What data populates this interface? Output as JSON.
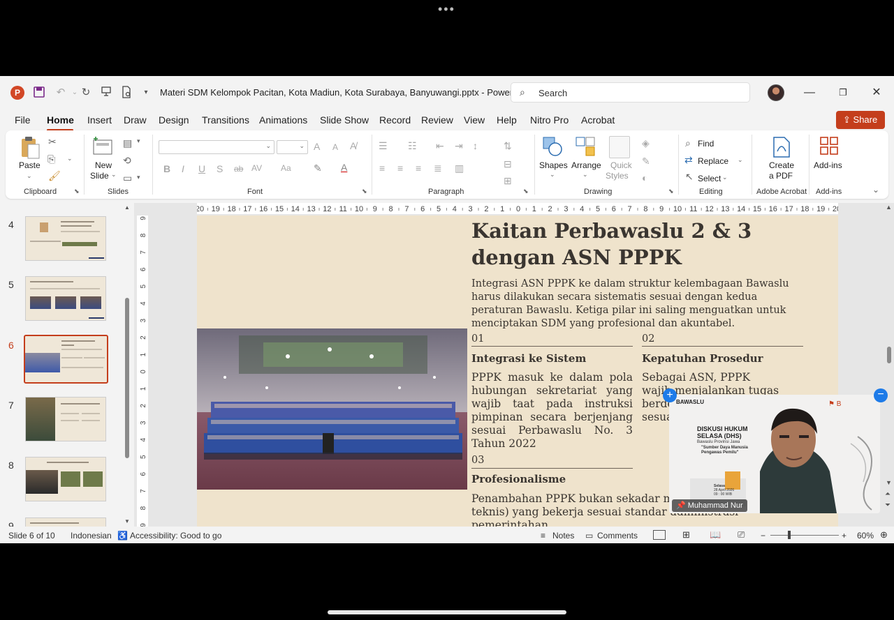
{
  "overlay": {
    "more_dots": "•••"
  },
  "titlebar": {
    "file_name": "Materi SDM Kelompok Pacitan, Kota Madiun, Kota Surabaya, Banyuwangi.pptx  -  PowerP...",
    "search_placeholder": "Search"
  },
  "menu": {
    "items": [
      "File",
      "Home",
      "Insert",
      "Draw",
      "Design",
      "Transitions",
      "Animations",
      "Slide Show",
      "Record",
      "Review",
      "View",
      "Help",
      "Nitro Pro",
      "Acrobat"
    ],
    "active": "Home",
    "share_label": "Share"
  },
  "ribbon": {
    "clipboard": {
      "paste": "Paste",
      "group": "Clipboard"
    },
    "slides": {
      "new_slide_line1": "New",
      "new_slide_line2": "Slide",
      "group": "Slides"
    },
    "font": {
      "group": "Font",
      "bold": "B",
      "italic": "I",
      "underline": "U",
      "shadow": "S",
      "strike": "ab",
      "spacing": "AV",
      "case": "Aa",
      "grow": "A",
      "shrink": "A"
    },
    "paragraph": {
      "group": "Paragraph"
    },
    "drawing": {
      "shapes": "Shapes",
      "arrange": "Arrange",
      "quick_styles_line1": "Quick",
      "quick_styles_line2": "Styles",
      "group": "Drawing"
    },
    "editing": {
      "find": "Find",
      "replace": "Replace",
      "select": "Select",
      "group": "Editing"
    },
    "acrobat": {
      "create_pdf_line1": "Create",
      "create_pdf_line2": "a PDF",
      "group": "Adobe Acrobat"
    },
    "addins": {
      "label": "Add-ins",
      "group": "Add-ins"
    }
  },
  "thumbnails": [
    {
      "number": "4",
      "active": false
    },
    {
      "number": "5",
      "active": false
    },
    {
      "number": "6",
      "active": true
    },
    {
      "number": "7",
      "active": false
    },
    {
      "number": "8",
      "active": false
    },
    {
      "number": "9",
      "active": false
    }
  ],
  "ruler": {
    "horizontal": [
      "20",
      "19",
      "18",
      "17",
      "16",
      "15",
      "14",
      "13",
      "12",
      "11",
      "10",
      "9",
      "8",
      "7",
      "6",
      "5",
      "4",
      "3",
      "2",
      "1",
      "0",
      "1",
      "2",
      "3",
      "4",
      "5",
      "6",
      "7",
      "8",
      "9",
      "10",
      "11",
      "12",
      "13",
      "14",
      "15",
      "16",
      "17",
      "18",
      "19",
      "20"
    ],
    "vertical": [
      "9",
      "8",
      "7",
      "6",
      "5",
      "4",
      "3",
      "2",
      "1",
      "0",
      "1",
      "2",
      "3",
      "4",
      "5",
      "6",
      "7",
      "8",
      "9"
    ]
  },
  "slide": {
    "title": "Kaitan Perbawaslu 2 & 3 dengan ASN PPPK",
    "intro": "Integrasi ASN PPPK ke dalam struktur kelembagaan Bawaslu harus dilakukan secara sistematis sesuai dengan kedua peraturan Bawaslu. Ketiga pilar ini saling menguatkan untuk menciptakan SDM yang profesional dan akuntabel.",
    "items": [
      {
        "num": "01",
        "heading": "Integrasi ke Sistem",
        "body": "PPPK masuk ke dalam pola hubungan sekretariat yang wajib taat pada instruksi pimpinan secara berjenjang sesuai Perbawaslu No. 3 Tahun 2022"
      },
      {
        "num": "02",
        "heading": "Kepatuhan Prosedur",
        "body": "Sebagai ASN, PPPK wajib menjalankan tugas berde ditetap penga sesua 2022"
      },
      {
        "num": "03",
        "heading": "Profesionalisme",
        "body": "Penambahan PPPK bukan sekadar mengisi slot ahli (tenaga teknis) yang bekerja sesuai standar administrasi pemerintahan"
      }
    ]
  },
  "video": {
    "participant": "Muhammad Nur",
    "org": "BAWASLU",
    "event_line1": "DISKUSI HUKUM",
    "event_line2": "SELASA (DHS)",
    "event_sub": "Bawaslu Provinsi Jawa",
    "topic_line1": "\"Sumber Daya Manusia",
    "topic_line2": "Pengawas Pemilu\"",
    "day": "Selasa",
    "date": "28 April 2026",
    "time": "09 : 00 WIB"
  },
  "status": {
    "slide_info": "Slide 6 of 10",
    "language": "Indonesian",
    "accessibility": "Accessibility: Good to go",
    "notes": "Notes",
    "comments": "Comments",
    "zoom": "60%"
  },
  "colors": {
    "accent": "#c43e1c",
    "slide_bg": "#efe3cc",
    "slide_text": "#3a3530"
  }
}
